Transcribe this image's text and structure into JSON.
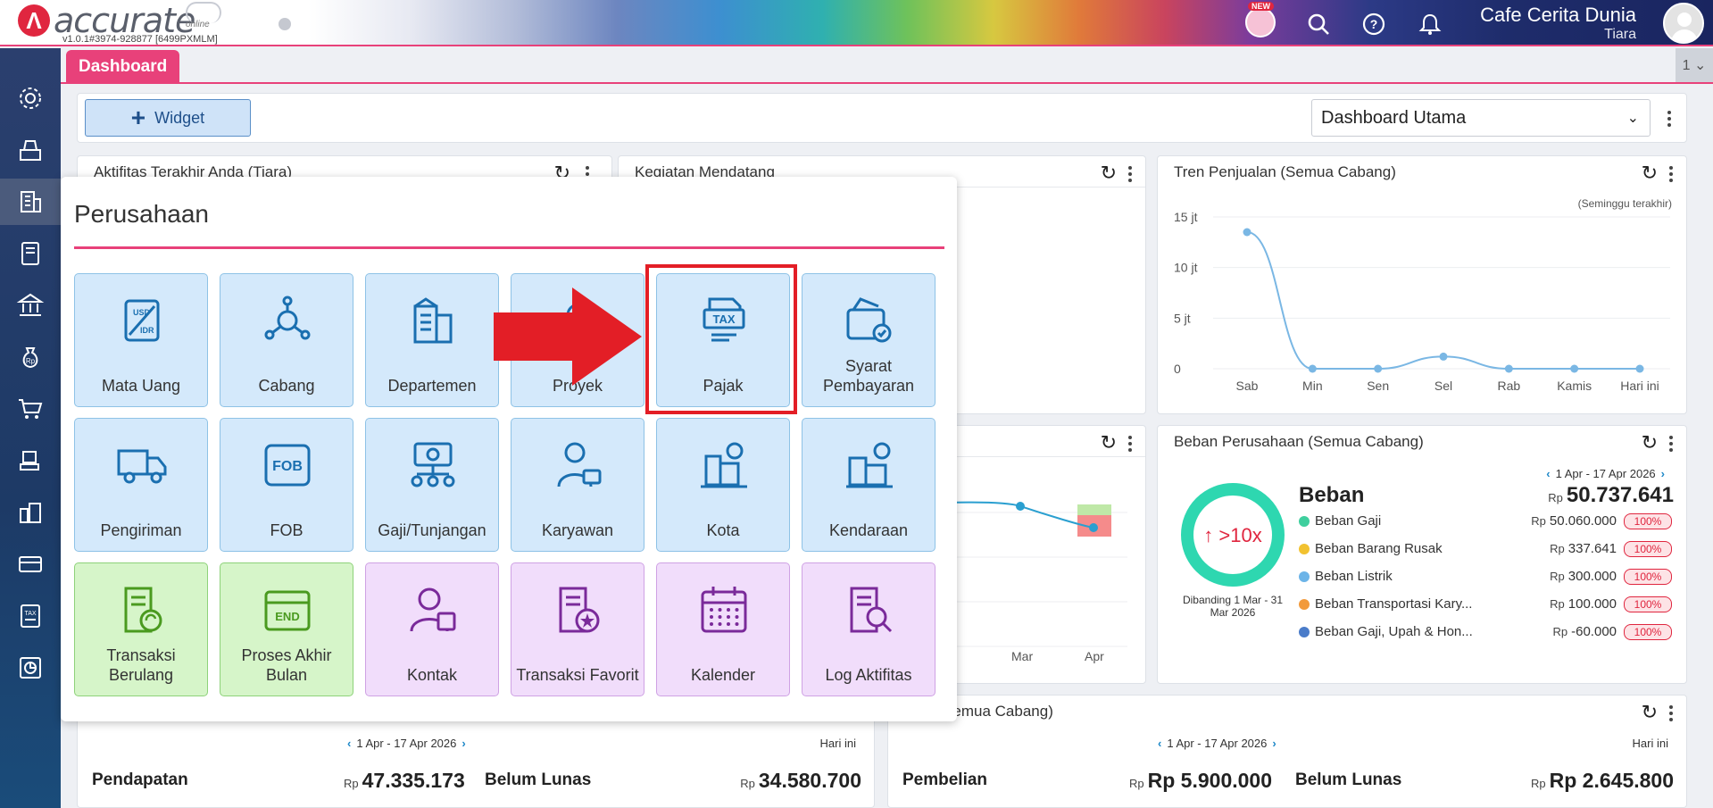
{
  "header": {
    "brand": "accurate",
    "brand_sub": "online",
    "version": "v1.0.1#3974-928877 [6499PXMLM]",
    "new_badge": "NEW",
    "company": "Cafe Cerita Dunia",
    "user": "Tiara"
  },
  "tabs": {
    "active": "Dashboard",
    "count": "1 ⌄"
  },
  "toolbar": {
    "widget_label": "Widget",
    "dashboard_select": "Dashboard Utama"
  },
  "widgets": {
    "aktifitas": {
      "title": "Aktifitas Terakhir Anda (Tiara)"
    },
    "kegiatan": {
      "title": "Kegiatan Mendatang"
    },
    "tren": {
      "title": "Tren Penjualan (Semua Cabang)",
      "note": "(Seminggu terakhir)"
    },
    "middle_chart": {
      "x_labels": [
        "Mar",
        "Apr"
      ]
    },
    "beban": {
      "title": "Beban Perusahaan (Semua Cabang)",
      "date_range": "1 Apr - 17 Apr 2026",
      "donut_label": "↑ >10x",
      "compare_note": "Dibanding 1 Mar - 31 Mar 2026",
      "heading": "Beban",
      "currency": "Rp",
      "total": "50.737.641",
      "items": [
        {
          "name": "Beban Gaji",
          "value": "50.060.000",
          "pct": "100%",
          "color": "#3fcf9e"
        },
        {
          "name": "Beban Barang Rusak",
          "value": "337.641",
          "pct": "100%",
          "color": "#f2c230"
        },
        {
          "name": "Beban Listrik",
          "value": "300.000",
          "pct": "100%",
          "color": "#6cb4e8"
        },
        {
          "name": "Beban Transportasi Kary...",
          "value": "100.000",
          "pct": "100%",
          "color": "#f29a3c"
        },
        {
          "name": "Beban Gaji, Upah & Hon...",
          "value": "-60.000",
          "pct": "100%",
          "color": "#4a7cc9"
        }
      ]
    },
    "penjualan": {
      "date_range": "1 Apr - 17 Apr 2026",
      "period": "Hari ini",
      "label_a": "Pendapatan",
      "value_a": "47.335.173",
      "label_b": "Belum Lunas",
      "value_b": "34.580.700"
    },
    "pembelian": {
      "title": "ian (Semua Cabang)",
      "date_range": "1 Apr - 17 Apr 2026",
      "period": "Hari ini",
      "label_a": "Pembelian",
      "value_a": "Rp 5.900.000",
      "label_b": "Belum Lunas",
      "value_b": "Rp 2.645.800"
    }
  },
  "chart_data": {
    "type": "line",
    "title": "Tren Penjualan (Semua Cabang)",
    "categories": [
      "Sab",
      "Min",
      "Sen",
      "Sel",
      "Rab",
      "Kamis",
      "Hari ini"
    ],
    "y_tick_labels": [
      "15 jt",
      "10 jt",
      "5 jt",
      "0"
    ],
    "ylim": [
      0,
      15000000
    ],
    "values": [
      13500000,
      0,
      0,
      1200000,
      0,
      0,
      0
    ],
    "grid": true,
    "legend": "none"
  },
  "popup": {
    "title": "Perusahaan",
    "tiles": [
      {
        "label": "Mata Uang",
        "icon": "currency-exchange-icon",
        "color": "blue"
      },
      {
        "label": "Cabang",
        "icon": "branch-network-icon",
        "color": "blue"
      },
      {
        "label": "Departemen",
        "icon": "building-icon",
        "color": "blue"
      },
      {
        "label": "Proyek",
        "icon": "project-icon",
        "color": "blue"
      },
      {
        "label": "Pajak",
        "icon": "tax-icon",
        "color": "blue"
      },
      {
        "label": "Syarat Pembayaran",
        "icon": "payment-terms-icon",
        "color": "blue"
      },
      {
        "label": "Pengiriman",
        "icon": "delivery-truck-icon",
        "color": "blue"
      },
      {
        "label": "FOB",
        "icon": "fob-icon",
        "color": "blue"
      },
      {
        "label": "Gaji/Tunjangan",
        "icon": "salary-icon",
        "color": "blue"
      },
      {
        "label": "Karyawan",
        "icon": "employee-icon",
        "color": "blue"
      },
      {
        "label": "Kota",
        "icon": "city-icon",
        "color": "blue"
      },
      {
        "label": "Kendaraan",
        "icon": "vehicle-icon",
        "color": "blue"
      },
      {
        "label": "Transaksi Berulang",
        "icon": "recurring-transaction-icon",
        "color": "green"
      },
      {
        "label": "Proses Akhir Bulan",
        "icon": "month-end-icon",
        "color": "green"
      },
      {
        "label": "Kontak",
        "icon": "contact-icon",
        "color": "purple"
      },
      {
        "label": "Transaksi Favorit",
        "icon": "favorite-transaction-icon",
        "color": "purple"
      },
      {
        "label": "Kalender",
        "icon": "calendar-icon",
        "color": "purple"
      },
      {
        "label": "Log Aktifitas",
        "icon": "activity-log-icon",
        "color": "purple"
      }
    ]
  },
  "colors": {
    "accent": "#e8417a",
    "brand": "#e0263f",
    "highlight": "#e31e26",
    "tile_blue": "#d4e9fb",
    "tile_green": "#d6f5c9",
    "tile_purple": "#f1ddfb"
  }
}
